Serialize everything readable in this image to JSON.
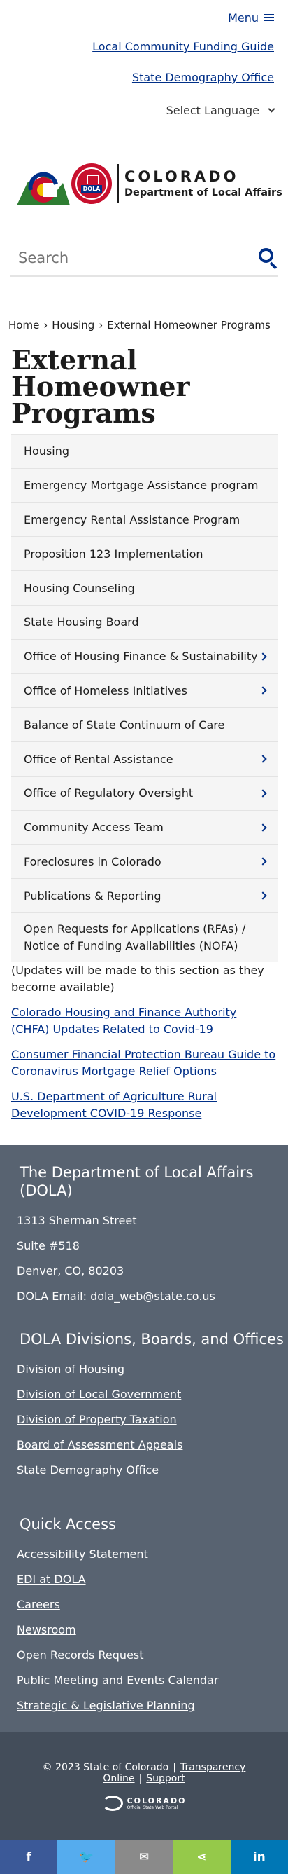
{
  "header": {
    "menu_label": "Menu",
    "links": [
      "Local Community Funding Guide",
      "State Demography Office"
    ],
    "language_label": "Select Language",
    "logo_state": "COLORADO",
    "logo_dept": "Department of Local Affairs",
    "logo_badge": "DOLA"
  },
  "search": {
    "placeholder": "Search"
  },
  "breadcrumb": {
    "home": "Home",
    "housing": "Housing",
    "current": "External Homeowner Programs"
  },
  "page": {
    "title": "External Homeowner Programs"
  },
  "subnav": [
    {
      "label": "Housing",
      "arrow": false
    },
    {
      "label": "Emergency Mortgage Assistance program",
      "arrow": false
    },
    {
      "label": "Emergency Rental Assistance Program",
      "arrow": false
    },
    {
      "label": "Proposition 123 Implementation",
      "arrow": false
    },
    {
      "label": "Housing Counseling",
      "arrow": false
    },
    {
      "label": "State Housing Board",
      "arrow": false
    },
    {
      "label": "Office of Housing Finance & Sustainability",
      "arrow": true
    },
    {
      "label": "Office of Homeless Initiatives",
      "arrow": true
    },
    {
      "label": "Balance of State Continuum of Care",
      "arrow": false
    },
    {
      "label": "Office of Rental Assistance",
      "arrow": true
    },
    {
      "label": "Office of Regulatory Oversight",
      "arrow": true
    },
    {
      "label": "Community Access Team",
      "arrow": true
    },
    {
      "label": "Foreclosures in Colorado",
      "arrow": true
    },
    {
      "label": "Publications & Reporting",
      "arrow": true
    },
    {
      "label": "Open Requests for Applications (RFAs) / Notice of Funding Availabilities (NOFA)",
      "arrow": false
    }
  ],
  "content": {
    "note": "(Updates will be made to this section as they become available)",
    "links": [
      "Colorado Housing and Finance Authority (CHFA) Updates Related to Covid-19",
      "Consumer Financial Protection Bureau Guide to Coronavirus Mortgage Relief Options",
      "U.S. Department of Agriculture Rural Development COVID-19 Response"
    ]
  },
  "footer": {
    "dola_heading": "The Department of Local Affairs (DOLA)",
    "address1": "1313 Sherman Street",
    "address2": "Suite  #518",
    "address3": "Denver, CO, 80203",
    "email_label": "DOLA Email:",
    "email": "dola_web@state.co.us",
    "divisions_heading": "DOLA Divisions, Boards, and Offices",
    "divisions": [
      "Division of Housing",
      "Division of Local Government",
      "Division of Property Taxation",
      "Board of Assessment Appeals",
      "State Demography Office"
    ],
    "quick_heading": "Quick Access",
    "quick": [
      "Accessibility Statement",
      "EDI at DOLA",
      "Careers",
      "Newsroom",
      "Open Records Request",
      "Public Meeting and Events Calendar",
      "Strategic & Legislative Planning"
    ],
    "copyright": "© 2023 State of Colorado",
    "transparency": "Transparency Online",
    "support": "Support",
    "state_logo_l1": "COLORADO",
    "state_logo_l2": "Official State Web Portal"
  },
  "share": [
    {
      "icon": "facebook-icon",
      "glyph": "f",
      "color": "#3b5998"
    },
    {
      "icon": "twitter-icon",
      "glyph": "🐦",
      "color": "#55acee"
    },
    {
      "icon": "email-icon",
      "glyph": "✉",
      "color": "#8a8a8a"
    },
    {
      "icon": "share-icon",
      "glyph": "⋖",
      "color": "#95c94a"
    },
    {
      "icon": "linkedin-icon",
      "glyph": "in",
      "color": "#0077b5"
    }
  ]
}
